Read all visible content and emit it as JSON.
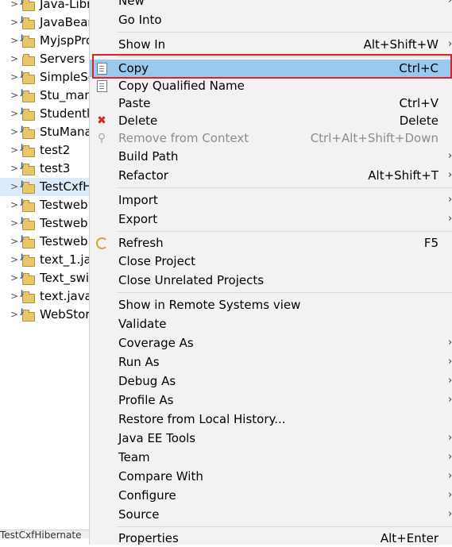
{
  "tree": {
    "items": [
      {
        "label": "Java-Libr",
        "selected": false
      },
      {
        "label": "JavaBear",
        "selected": false
      },
      {
        "label": "MyjspPro",
        "selected": false
      },
      {
        "label": "Servers",
        "selected": false
      },
      {
        "label": "SimpleSe",
        "selected": false
      },
      {
        "label": "Stu_man",
        "selected": false
      },
      {
        "label": "Studentl",
        "selected": false
      },
      {
        "label": "StuMana",
        "selected": false
      },
      {
        "label": "test2",
        "selected": false
      },
      {
        "label": "test3",
        "selected": false
      },
      {
        "label": "TestCxfH",
        "selected": true
      },
      {
        "label": "Testweb",
        "selected": false
      },
      {
        "label": "Testweb",
        "selected": false
      },
      {
        "label": "Testweb",
        "selected": false
      },
      {
        "label": "text_1.ja",
        "selected": false
      },
      {
        "label": "Text_swi",
        "selected": false
      },
      {
        "label": "text.java",
        "selected": false
      },
      {
        "label": "WebStor",
        "selected": false
      }
    ],
    "status_text": "TestCxfHibernate"
  },
  "menu": {
    "items": [
      {
        "label": "New",
        "shortcut": "",
        "submenu": true
      },
      {
        "label": "Go Into",
        "shortcut": "",
        "submenu": false
      },
      {
        "label": "Show In",
        "shortcut": "Alt+Shift+W",
        "submenu": true
      },
      {
        "label": "Copy",
        "shortcut": "Ctrl+C",
        "submenu": false,
        "highlighted": true,
        "icon": "copy-icon"
      },
      {
        "label": "Copy Qualified Name",
        "shortcut": "",
        "submenu": false,
        "icon": "copy-qualified-icon"
      },
      {
        "label": "Paste",
        "shortcut": "Ctrl+V",
        "submenu": false,
        "icon": "paste-icon"
      },
      {
        "label": "Delete",
        "shortcut": "Delete",
        "submenu": false,
        "icon": "delete-icon"
      },
      {
        "label": "Remove from Context",
        "shortcut": "Ctrl+Alt+Shift+Down",
        "submenu": false,
        "disabled": true,
        "icon": "remove-context-icon"
      },
      {
        "label": "Build Path",
        "shortcut": "",
        "submenu": true
      },
      {
        "label": "Refactor",
        "shortcut": "Alt+Shift+T",
        "submenu": true
      },
      {
        "label": "Import",
        "shortcut": "",
        "submenu": true
      },
      {
        "label": "Export",
        "shortcut": "",
        "submenu": true
      },
      {
        "label": "Refresh",
        "shortcut": "F5",
        "submenu": false,
        "icon": "refresh-icon"
      },
      {
        "label": "Close Project",
        "shortcut": "",
        "submenu": false
      },
      {
        "label": "Close Unrelated Projects",
        "shortcut": "",
        "submenu": false
      },
      {
        "label": "Show in Remote Systems view",
        "shortcut": "",
        "submenu": false
      },
      {
        "label": "Validate",
        "shortcut": "",
        "submenu": false
      },
      {
        "label": "Coverage As",
        "shortcut": "",
        "submenu": true
      },
      {
        "label": "Run As",
        "shortcut": "",
        "submenu": true
      },
      {
        "label": "Debug As",
        "shortcut": "",
        "submenu": true
      },
      {
        "label": "Profile As",
        "shortcut": "",
        "submenu": true
      },
      {
        "label": "Restore from Local History...",
        "shortcut": "",
        "submenu": false
      },
      {
        "label": "Java EE Tools",
        "shortcut": "",
        "submenu": true
      },
      {
        "label": "Team",
        "shortcut": "",
        "submenu": true
      },
      {
        "label": "Compare With",
        "shortcut": "",
        "submenu": true
      },
      {
        "label": "Configure",
        "shortcut": "",
        "submenu": true
      },
      {
        "label": "Source",
        "shortcut": "",
        "submenu": true
      },
      {
        "label": "Properties",
        "shortcut": "Alt+Enter",
        "submenu": false
      }
    ],
    "submenu_arrow": "›"
  },
  "colors": {
    "highlight": "#99c9ef",
    "highlight_outline": "#e0211f",
    "menu_background": "#f2f2f2"
  }
}
